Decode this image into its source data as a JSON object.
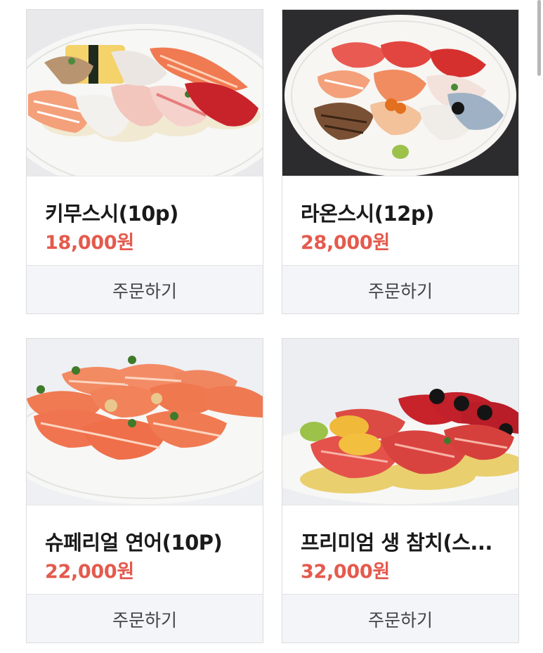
{
  "products": [
    {
      "name": "키무스시(10p)",
      "price": "18,000원",
      "order_label": "주문하기"
    },
    {
      "name": "라온스시(12p)",
      "price": "28,000원",
      "order_label": "주문하기"
    },
    {
      "name": "슈페리얼 연어(10P)",
      "price": "22,000원",
      "order_label": "주문하기"
    },
    {
      "name": "프리미엄 생 참치(스...",
      "price": "32,000원",
      "order_label": "주문하기"
    }
  ],
  "colors": {
    "price": "#e45a4d",
    "button_bg": "#f4f5f8",
    "salmon": "#f07a52",
    "tuna": "#c8232b"
  }
}
